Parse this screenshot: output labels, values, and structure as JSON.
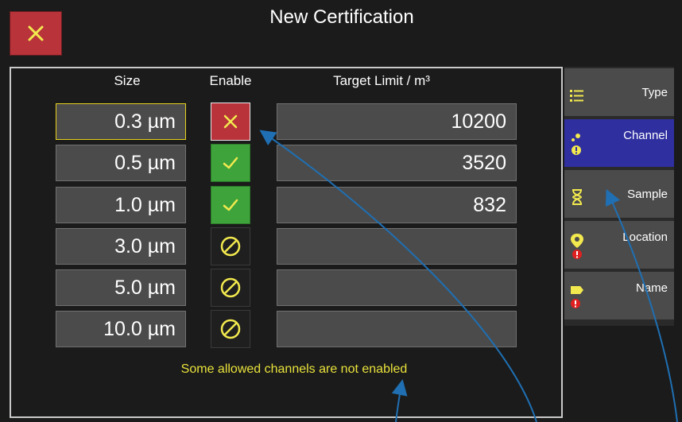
{
  "header": {
    "title": "New Certification",
    "close_icon": "close-icon"
  },
  "columns": {
    "size": "Size",
    "enable": "Enable",
    "target": "Target Limit / m³"
  },
  "rows": [
    {
      "size": "0.3 µm",
      "enable": "disabled-x",
      "target": "10200"
    },
    {
      "size": "0.5 µm",
      "enable": "enabled",
      "target": "3520"
    },
    {
      "size": "1.0 µm",
      "enable": "enabled",
      "target": "832"
    },
    {
      "size": "3.0 µm",
      "enable": "not-allowed",
      "target": ""
    },
    {
      "size": "5.0 µm",
      "enable": "not-allowed",
      "target": ""
    },
    {
      "size": "10.0 µm",
      "enable": "not-allowed",
      "target": ""
    }
  ],
  "warning": "Some allowed channels are not enabled",
  "sidebar": {
    "items": [
      {
        "label": "Type",
        "icon": "list-icon",
        "active": false
      },
      {
        "label": "Channel",
        "icon": "channel-icon",
        "active": true
      },
      {
        "label": "Sample",
        "icon": "hourglass-icon",
        "active": false
      },
      {
        "label": "Location",
        "icon": "location-pin-icon",
        "active": false
      },
      {
        "label": "Name",
        "icon": "tag-icon",
        "active": false
      }
    ]
  },
  "colors": {
    "accent_blue": "#2f2f9f",
    "danger_red": "#b8333a",
    "ok_green": "#3ea33b",
    "warning_yellow": "#e9e23b",
    "annotation_blue": "#1f6fb2"
  }
}
